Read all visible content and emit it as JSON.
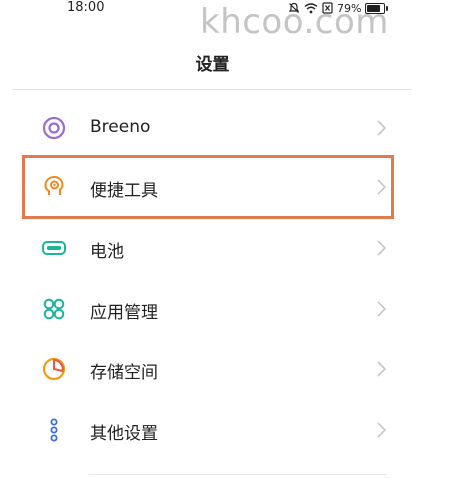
{
  "status_bar": {
    "time": "18:00",
    "battery_percent": "79%",
    "battery_level": 0.79,
    "icons": [
      "mute-icon",
      "wifi-icon",
      "sim-icon",
      "battery-icon"
    ]
  },
  "watermark": "khcoo.com",
  "header": {
    "title": "设置"
  },
  "settings": {
    "items": [
      {
        "label": "Breeno",
        "icon": "breeno-icon"
      },
      {
        "label": "便捷工具",
        "icon": "convenience-tools-icon",
        "highlighted": true
      },
      {
        "label": "电池",
        "icon": "battery-icon"
      },
      {
        "label": "应用管理",
        "icon": "app-management-icon"
      },
      {
        "label": "存储空间",
        "icon": "storage-icon"
      },
      {
        "label": "其他设置",
        "icon": "other-settings-icon"
      }
    ]
  },
  "colors": {
    "highlight_border": "#e37a4d",
    "breeno": "#9b6bd1",
    "convenience_tools": "#f08a1c",
    "battery": "#1cb59a",
    "app_management": "#1cb59a",
    "storage": "#f29c11",
    "other_settings": "#3d6fd6"
  }
}
